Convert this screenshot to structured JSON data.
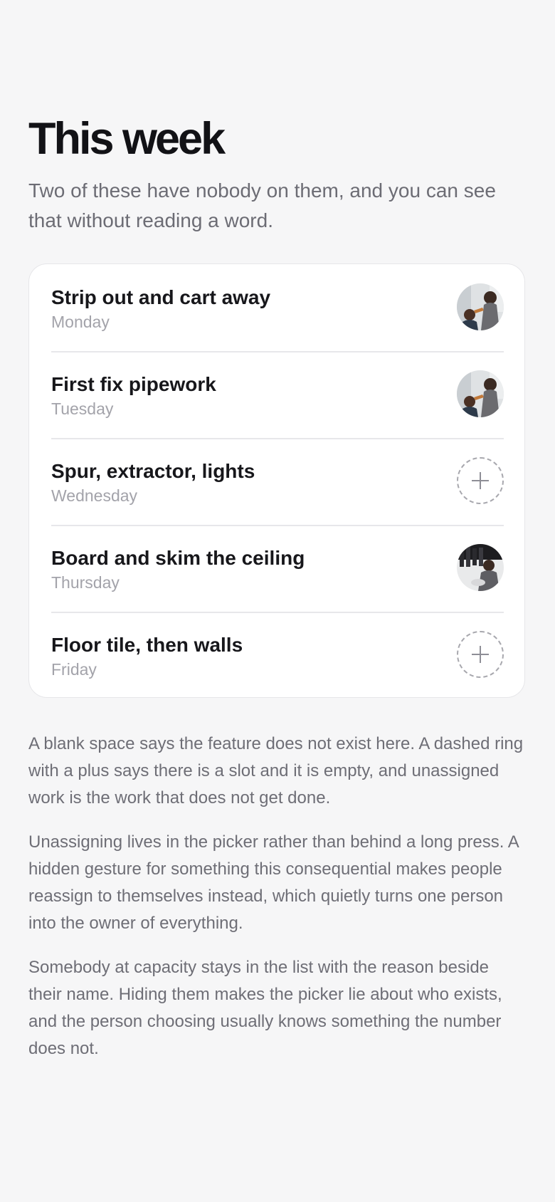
{
  "header": {
    "title": "This week",
    "subtitle": "Two of these have nobody on them, and you can see that without reading a word."
  },
  "tasks": [
    {
      "title": "Strip out and cart away",
      "day": "Monday",
      "assigned": true,
      "avatar_icon": "person-photo-avatar"
    },
    {
      "title": "First fix pipework",
      "day": "Tuesday",
      "assigned": true,
      "avatar_icon": "person-photo-avatar"
    },
    {
      "title": "Spur, extractor, lights",
      "day": "Wednesday",
      "assigned": false,
      "avatar_icon": "plus-icon"
    },
    {
      "title": "Board and skim the ceiling",
      "day": "Thursday",
      "assigned": true,
      "avatar_icon": "person-photo-avatar"
    },
    {
      "title": "Floor tile, then walls",
      "day": "Friday",
      "assigned": false,
      "avatar_icon": "plus-icon"
    }
  ],
  "notes": [
    "A blank space says the feature does not exist here. A dashed ring with a plus says there is a slot and it is empty, and unassigned work is the work that does not get done.",
    "Unassigning lives in the picker rather than behind a long press. A hidden gesture for something this consequential makes people reassign to themselves instead, which quietly turns one person into the owner of everything.",
    "Somebody at capacity stays in the list with the reason beside their name. Hiding them makes the picker lie about who exists, and the person choosing usually knows something the number does not."
  ],
  "colors": {
    "background": "#f6f6f7",
    "card": "#ffffff",
    "title": "#121216",
    "secondary_text": "#6e6e76",
    "day_text": "#a3a3aa",
    "divider": "#e7e7ea",
    "empty_ring": "#a8a8ae"
  }
}
